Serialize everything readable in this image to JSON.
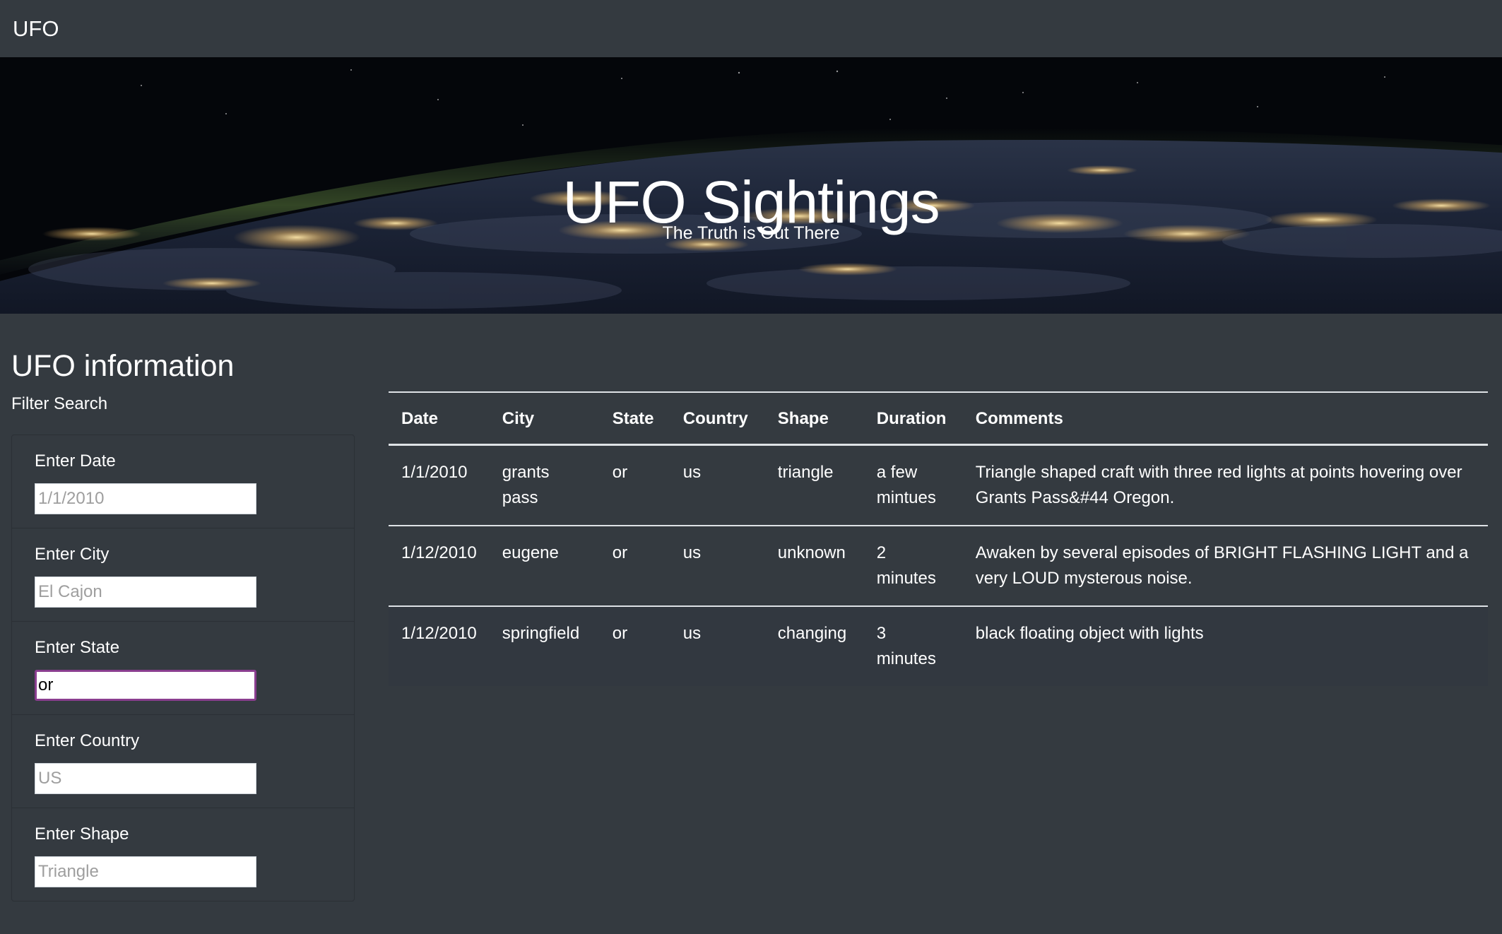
{
  "navbar": {
    "brand": "UFO"
  },
  "hero": {
    "title": "UFO Sightings",
    "subtitle": "The Truth is Out There"
  },
  "sidebar": {
    "heading": "UFO information",
    "filter_label": "Filter Search",
    "filters": [
      {
        "label": "Enter Date",
        "placeholder": "1/1/2010",
        "value": ""
      },
      {
        "label": "Enter City",
        "placeholder": "El Cajon",
        "value": ""
      },
      {
        "label": "Enter State",
        "placeholder": "",
        "value": "or"
      },
      {
        "label": "Enter Country",
        "placeholder": "US",
        "value": ""
      },
      {
        "label": "Enter Shape",
        "placeholder": "Triangle",
        "value": ""
      }
    ]
  },
  "table": {
    "headers": [
      "Date",
      "City",
      "State",
      "Country",
      "Shape",
      "Duration",
      "Comments"
    ],
    "rows": [
      [
        "1/1/2010",
        "grants pass",
        "or",
        "us",
        "triangle",
        "a few mintues",
        "Triangle shaped craft with three red lights at points hovering over Grants Pass&#44 Oregon."
      ],
      [
        "1/12/2010",
        "eugene",
        "or",
        "us",
        "unknown",
        "2 minutes",
        "Awaken by several episodes of BRIGHT FLASHING LIGHT and a very LOUD mysterous noise."
      ],
      [
        "1/12/2010",
        "springfield",
        "or",
        "us",
        "changing",
        "3 minutes",
        "black floating object with lights"
      ]
    ]
  },
  "colors": {
    "page_background": "#343a40",
    "focus_border": "#8a3e8f",
    "text": "#ffffff"
  }
}
